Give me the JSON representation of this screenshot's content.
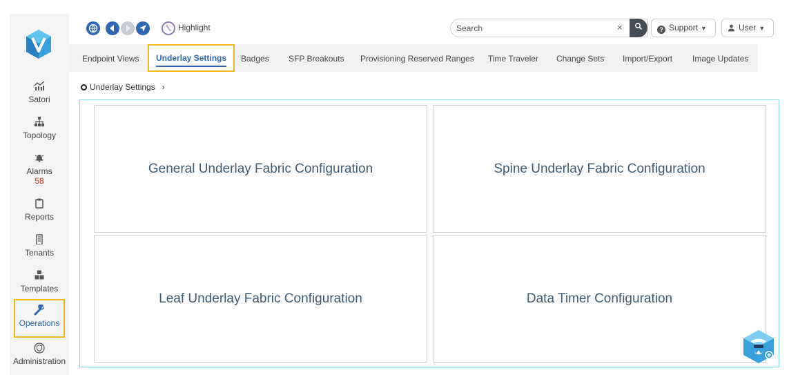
{
  "sidebar": {
    "items": [
      {
        "label": "Satori",
        "icon": "satori-icon"
      },
      {
        "label": "Topology",
        "icon": "topology-icon"
      },
      {
        "label": "Alarms",
        "icon": "alarm-bell-icon",
        "count": "58"
      },
      {
        "label": "Reports",
        "icon": "clipboard-icon"
      },
      {
        "label": "Tenants",
        "icon": "building-icon"
      },
      {
        "label": "Templates",
        "icon": "cubes-icon"
      },
      {
        "label": "Operations",
        "icon": "wrench-icon",
        "active": true
      },
      {
        "label": "Administration",
        "icon": "shield-icon"
      }
    ]
  },
  "toolbar": {
    "highlight_label": "Highlight",
    "search_placeholder": "Search",
    "search_clear": "×",
    "support_label": "Support",
    "user_label": "User"
  },
  "tabs": [
    {
      "label": "Endpoint Views"
    },
    {
      "label": "Underlay Settings",
      "active": true
    },
    {
      "label": "Badges"
    },
    {
      "label": "SFP Breakouts"
    },
    {
      "label": "Provisioning Reserved Ranges"
    },
    {
      "label": "Time Traveler"
    },
    {
      "label": "Change Sets"
    },
    {
      "label": "Import/Export"
    },
    {
      "label": "Image Updates"
    }
  ],
  "breadcrumb": {
    "label": "Underlay Settings",
    "arrow": "›"
  },
  "cards": [
    {
      "label": "General Underlay Fabric Configuration"
    },
    {
      "label": "Spine Underlay Fabric Configuration"
    },
    {
      "label": "Leaf Underlay Fabric Configuration"
    },
    {
      "label": "Data Timer Configuration"
    }
  ],
  "colors": {
    "accent": "#2f67b1",
    "highlight_border": "#f3b61f",
    "alarm_count": "#d9352a",
    "content_border": "#7ee0e5",
    "card_text": "#3f5a70"
  }
}
